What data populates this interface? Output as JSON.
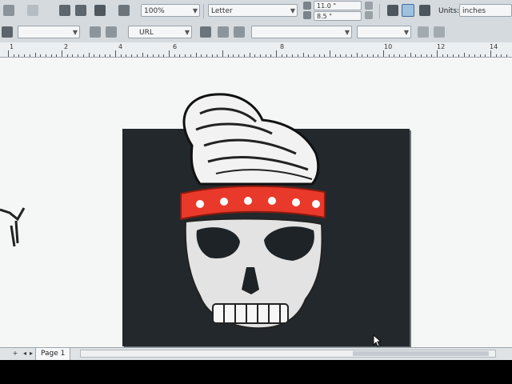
{
  "toolbar1": {
    "zoom_value": "100%",
    "paper_size": "Letter",
    "width_value": "11.0 \"",
    "height_value": "8.5 \"",
    "units_label": "Units:",
    "units_value": "inches"
  },
  "toolbar2": {
    "url_label": "URL"
  },
  "ruler": {
    "numbers": [
      "1",
      "2",
      "4",
      "6",
      "8",
      "10",
      "12",
      "14"
    ]
  },
  "statusbar": {
    "page_tab_label": "Page 1"
  },
  "colors": {
    "page_background": "#22282b",
    "headband_red": "#e8392b",
    "toolbar_bg": "#d5dade"
  }
}
